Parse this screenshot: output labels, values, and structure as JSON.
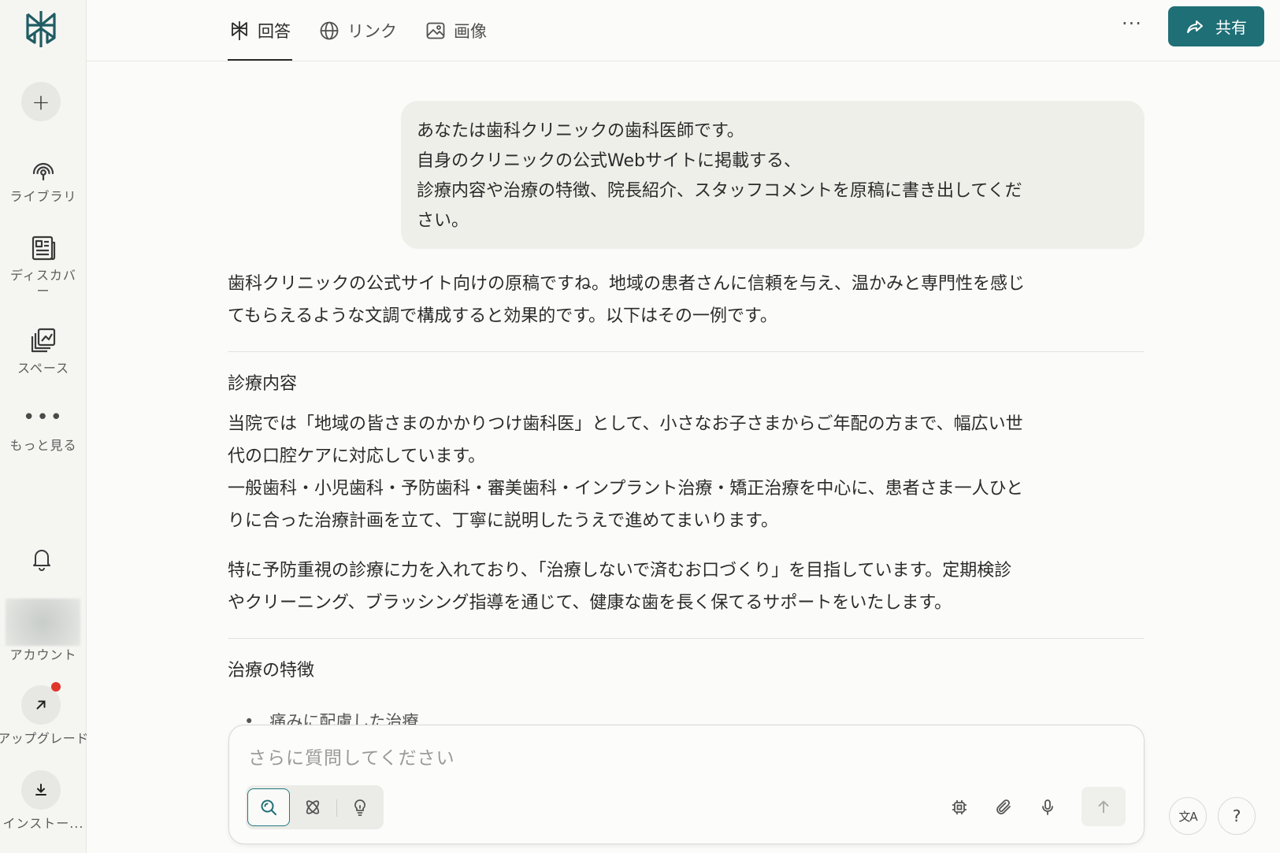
{
  "sidebar": {
    "new_button": "+",
    "items": [
      {
        "label": "ライブラリ",
        "icon": "library-icon"
      },
      {
        "label": "ディスカバー",
        "icon": "discover-icon"
      },
      {
        "label": "スペース",
        "icon": "spaces-icon"
      },
      {
        "label": "もっと見る",
        "icon": "more-icon"
      }
    ],
    "account_label": "アカウント",
    "upgrade_label": "アップグレード",
    "install_label": "インストー..."
  },
  "tabs": [
    {
      "label": "回答",
      "icon": "perplexity-icon",
      "active": true
    },
    {
      "label": "リンク",
      "icon": "globe-icon",
      "active": false
    },
    {
      "label": "画像",
      "icon": "image-icon",
      "active": false
    }
  ],
  "header": {
    "more": "···",
    "share_label": "共有"
  },
  "user_message": {
    "lines": [
      "あなたは歯科クリニックの歯科医師です。",
      "自身のクリニックの公式Webサイトに掲載する、",
      "診療内容や治療の特徴、院長紹介、スタッフコメントを原稿に書き出してくだ",
      "さい。"
    ]
  },
  "answer": {
    "intro": [
      "歯科クリニックの公式サイト向けの原稿ですね。地域の患者さんに信頼を与え、温かみと専門性を感じ",
      "てもらえるような文調で構成すると効果的です。以下はその一例です。"
    ],
    "section1_title": "診療内容",
    "section1_p1": [
      "当院では「地域の皆さまのかかりつけ歯科医」として、小さなお子さまからご年配の方まで、幅広い世",
      "代の口腔ケアに対応しています。",
      "一般歯科・小児歯科・予防歯科・審美歯科・インプラント治療・矯正治療を中心に、患者さま一人ひと",
      "りに合った治療計画を立て、丁寧に説明したうえで進めてまいります。"
    ],
    "section1_p2": [
      "特に予防重視の診療に力を入れており、「治療しないで済むお口づくり」を目指しています。定期検診",
      "やクリーニング、ブラッシング指導を通じて、健康な歯を長く保てるサポートをいたします。"
    ],
    "section2_title": "治療の特徴",
    "section2_bullet1": "痛みに配慮した治療"
  },
  "composer": {
    "placeholder": "さらに質問してください"
  },
  "footer": {
    "translate": "文A",
    "help": "?"
  },
  "colors": {
    "accent": "#1f6f76",
    "background": "#fbfbf9",
    "sidebar_bg": "#f5f5f2",
    "bubble_bg": "#efefea",
    "notification": "#e0352b"
  }
}
